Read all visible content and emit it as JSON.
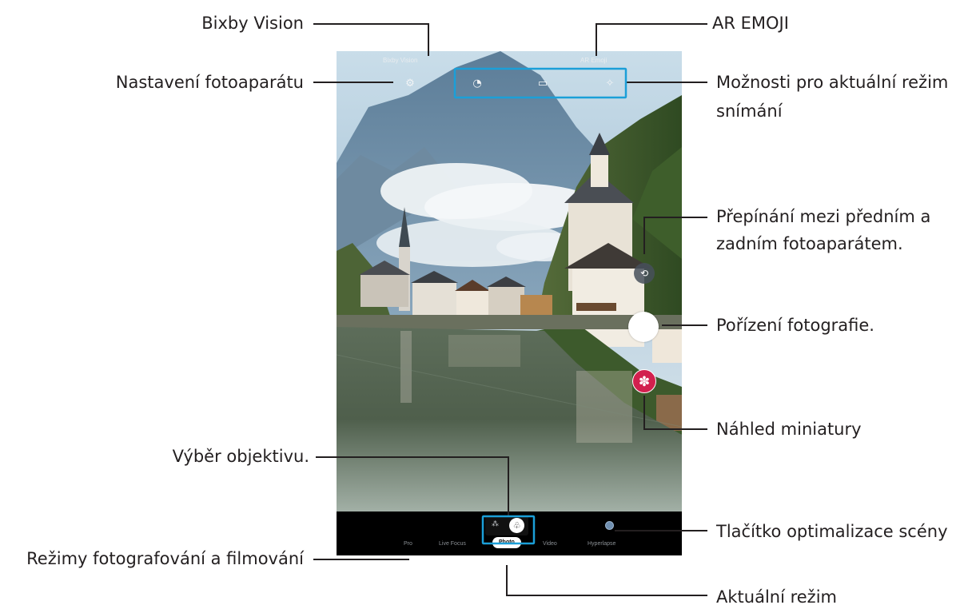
{
  "callouts": {
    "bixby_vision": "Bixby Vision",
    "ar_emoji": "AR EMOJI",
    "camera_settings": "Nastavení fotoaparátu",
    "mode_options_line1": "Možnosti pro aktuální režim",
    "mode_options_line2": "snímání",
    "switch_camera_line1": "Přepínání mezi předním a",
    "switch_camera_line2": "zadním fotoaparátem.",
    "take_picture": "Pořízení fotografie.",
    "thumbnail_preview": "Náhled miniatury",
    "lens_selection": "Výběr objektivu.",
    "scene_optimizer_button": "Tlačítko optimalizace scény",
    "shooting_modes": "Režimy fotografování a filmování",
    "current_mode": "Aktuální režim"
  },
  "camera": {
    "status_left": "Bixby Vision",
    "status_right": "AR Emoji",
    "modes": [
      "Pro",
      "Live Focus",
      "Photo",
      "Video",
      "Hyperlapse"
    ],
    "current_mode": "Photo",
    "icons": {
      "settings": "gear-icon",
      "timer": "timer-icon",
      "ratio": "aspect-ratio-icon",
      "effects": "magic-wand-icon",
      "switch_camera": "camera-switch-icon",
      "lens_wide": "wide-lens-icon",
      "lens_normal": "normal-lens-icon",
      "thumbnail": "flower-icon",
      "scene_optimizer": "scene-optimizer-icon"
    },
    "glyphs": {
      "settings": "⚙",
      "timer": "◔",
      "ratio": "▭",
      "effects": "✧",
      "switch_camera": "⟲",
      "lens_wide": "⁂",
      "lens_normal": "♧",
      "thumbnail": "✽"
    }
  }
}
